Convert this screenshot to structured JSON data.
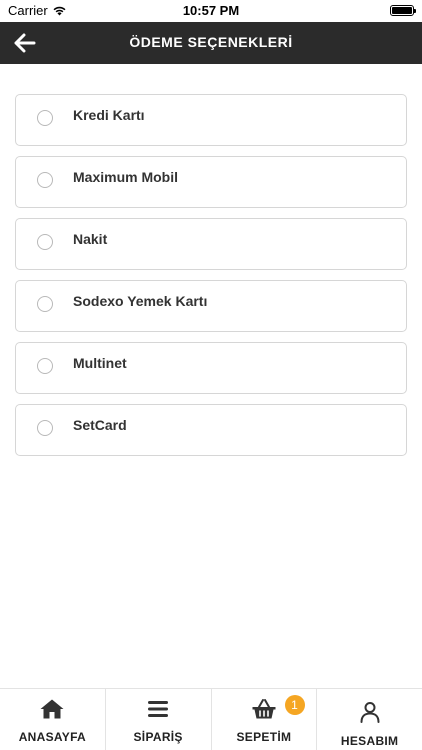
{
  "status_bar": {
    "carrier": "Carrier",
    "time": "10:57 PM",
    "battery_level": 1.0
  },
  "header": {
    "title": "ÖDEME SEÇENEKLERİ",
    "back_icon": "arrow-left-icon"
  },
  "payment_options": [
    {
      "label": "Kredi Kartı",
      "selected": false
    },
    {
      "label": "Maximum Mobil",
      "selected": false
    },
    {
      "label": "Nakit",
      "selected": false
    },
    {
      "label": "Sodexo Yemek Kartı",
      "selected": false
    },
    {
      "label": "Multinet",
      "selected": false
    },
    {
      "label": "SetCard",
      "selected": false
    }
  ],
  "tab_bar": {
    "tabs": [
      {
        "label": "ANASAYFA",
        "icon": "home-icon"
      },
      {
        "label": "SİPARİŞ",
        "icon": "menu-list-icon"
      },
      {
        "label": "SEPETİM",
        "icon": "basket-icon"
      },
      {
        "label": "HESABIM",
        "icon": "user-icon"
      }
    ],
    "cart_count": "1"
  },
  "colors": {
    "header_bg": "#2b2b2b",
    "badge": "#f5a623",
    "border": "#d6d6d6"
  }
}
